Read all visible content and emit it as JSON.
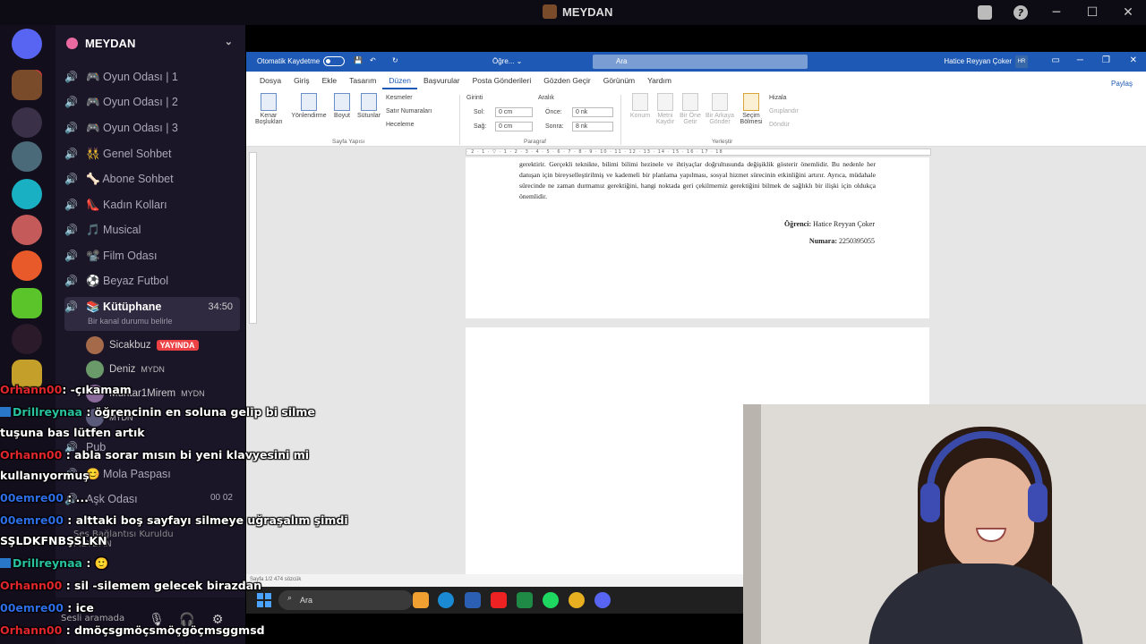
{
  "discord": {
    "window_title": "MEYDAN",
    "server_name": "MEYDAN",
    "rail_badge": "2",
    "channels": [
      {
        "label": "🎮 Oyun Odası | 1"
      },
      {
        "label": "🎮 Oyun Odası | 2"
      },
      {
        "label": "🎮 Oyun Odası | 3"
      },
      {
        "label": "👯 Genel Sohbet"
      },
      {
        "label": "🦴 Abone Sohbet"
      },
      {
        "label": "👠 Kadın Kolları"
      },
      {
        "label": "🎵 Musical"
      },
      {
        "label": "📽️ Film Odası"
      },
      {
        "label": "⚽ Beyaz Futbol"
      }
    ],
    "active_channel": {
      "label": "📚 Kütüphane",
      "timer": "34:50",
      "status": "Bir kanal durumu belirle"
    },
    "voice_users": [
      {
        "name": "Sicakbuz",
        "badge": "YAYINDA"
      },
      {
        "name": "Deniz",
        "tag": "MYDN"
      },
      {
        "name": "Muhtar1Mirem",
        "tag": "MYDN"
      },
      {
        "name": "MYDN"
      }
    ],
    "more_channels": [
      {
        "label": "Pub"
      },
      {
        "label": "😊 Mola Paspası"
      },
      {
        "label": "Aşk Odası",
        "count1": "00",
        "count2": "02"
      }
    ],
    "connection": {
      "title": "Ses Bağlantısı Kuruldu",
      "subtitle": "MEYDAN"
    },
    "userbar": {
      "status": "Sesli aramada"
    }
  },
  "word": {
    "autosave_label": "Otomatik Kaydetme",
    "doc_name": "Öğre... ⌄",
    "search_placeholder": "Ara",
    "user_name": "Hatice Reyyan Çoker",
    "user_initials": "HR",
    "tabs": [
      "Dosya",
      "Giriş",
      "Ekle",
      "Tasarım",
      "Düzen",
      "Başvurular",
      "Posta Gönderileri",
      "Gözden Geçir",
      "Görünüm",
      "Yardım"
    ],
    "selected_tab": "Düzen",
    "share_label": "Paylaş",
    "ribbon": {
      "margins": "Kenar Boşlukları",
      "orientation": "Yönlendirme",
      "size": "Boyut",
      "columns": "Sütunlar",
      "breaks": "Kesmeler",
      "line_numbers": "Satır Numaraları",
      "hyphenation": "Heceleme",
      "page_setup_group": "Sayfa Yapısı",
      "indent_label": "Girinti",
      "spacing_label": "Aralık",
      "left_label": "Sol:",
      "right_label": "Sağ:",
      "left_val": "0 cm",
      "right_val": "0 cm",
      "before_label": "Önce:",
      "after_label": "Sonra:",
      "before_val": "0 nk",
      "after_val": "8 nk",
      "paragraph_group": "Paragraf",
      "position": "Konum",
      "wrap_text": "Metni Kaydır",
      "bring_forward": "Bir Öne Getir",
      "send_backward": "Bir Arkaya Gönder",
      "selection_pane": "Seçim Bölmesi",
      "align": "Hizala",
      "group": "Gruplandır",
      "rotate": "Döndür",
      "arrange_group": "Yerleştir"
    },
    "doc_text": "gerektirir. Gerçekli teknikte, bilimi bilimi hezinele ve ihtiyaçlar doğrultusunda değişiklik gösterir önemlidir. Bu nedenle her danışan için bireyselleştirilmiş ve kademeli bir planlama yapılması, sosyal hizmet sürecinin etkinliğini artırır. Ayrıca, müdahale sürecinde ne zaman durmamız gerektiğini, hangi noktada geri çekilmemiz gerektiğini bilmek de sağlıklı bir ilişki için oldukça önemlidir.",
    "student_label": "Öğrenci:",
    "student_name": "Hatice Reyyan Çoker",
    "number_label": "Numara:",
    "number_val": "2250395055",
    "status_bar": "Sayfa 1/2   474 sözcük"
  },
  "taskbar": {
    "search_placeholder": "Ara"
  },
  "chat": [
    {
      "user": "Orhann00",
      "msg": ": -çıkamam"
    },
    {
      "user": "Drillreynaa",
      "msg": ": öğrencinin en soluna gelip bi silme"
    },
    {
      "user": "",
      "msg": "tuşuna bas lütfen artık"
    },
    {
      "user": "Orhann00",
      "msg": ": abla sorar mısın bi yeni klavyesini mi"
    },
    {
      "user": "",
      "msg": "kullanıyormuş"
    },
    {
      "user": "00emre00",
      "msg": ": ..."
    },
    {
      "user": "00emre00",
      "msg": ": alttaki boş sayfayı silmeye uğraşalım şimdi"
    },
    {
      "user": "",
      "msg": "SŞLDKFNBŞSLKN"
    },
    {
      "user": "Drillreynaa",
      "msg": ": 🙂"
    },
    {
      "user": "Orhann00",
      "msg": ": sil -silemem gelecek birazdan"
    },
    {
      "user": "00emre00",
      "msg": ": ice"
    },
    {
      "user": "Orhann00",
      "msg": ": dmöçsgmöçsmöçgöçmsggmsd"
    }
  ],
  "colors": {
    "discord_bg": "#1a1527",
    "word_blue": "#1e5ab5",
    "chat_orhan": "#e0262c",
    "chat_drill": "#28c2a0",
    "chat_emre": "#2d6de6",
    "live_red": "#ed4245"
  }
}
